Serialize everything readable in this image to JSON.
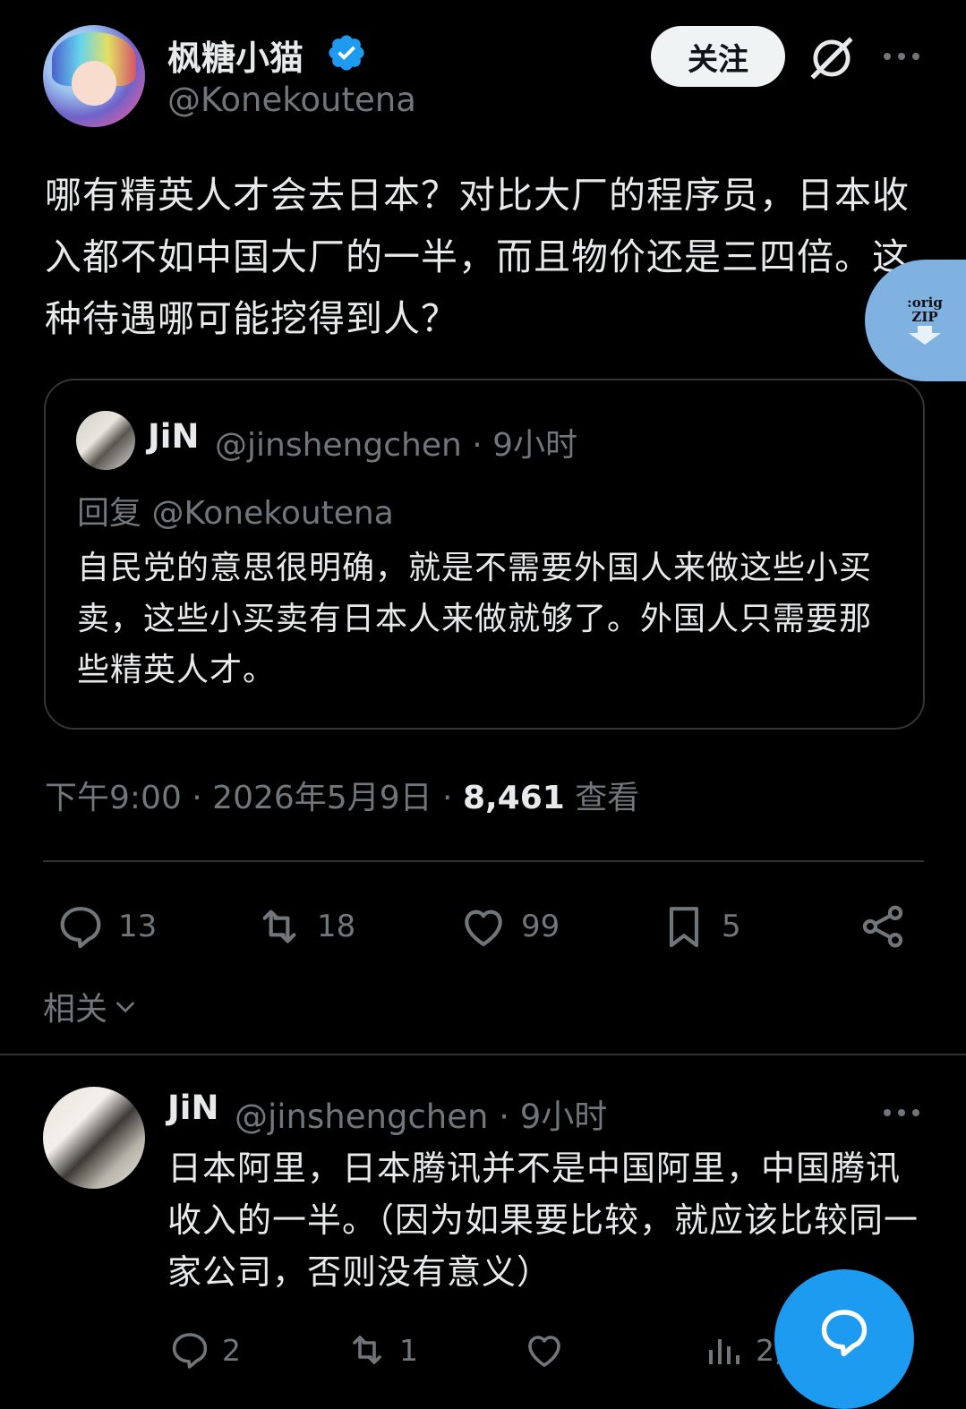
{
  "tweet": {
    "author_name": "枫糖小猫",
    "author_handle": "@Konekoutena",
    "follow_label": "关注",
    "text": "哪有精英人才会去日本？对比大厂的程序员，日本收入都不如中国大厂的一半，而且物价还是三四倍。这种待遇哪可能挖得到人？",
    "time": "下午9:00 · 2026年5月9日 · ",
    "views": "8,461",
    "views_label": " 查看",
    "stats": {
      "replies": "13",
      "retweets": "18",
      "likes": "99",
      "bookmarks": "5"
    }
  },
  "zip_badge": {
    "line1": ":orig",
    "line2": "ZIP"
  },
  "quote": {
    "name": "JiN",
    "meta": "@jinshengchen · 9小时",
    "reply_to": "回复 @Konekoutena",
    "text": "自民党的意思很明确，就是不需要外国人来做这些小买卖，这些小买卖有日本人来做就够了。外国人只需要那些精英人才。"
  },
  "related_label": "相关",
  "reply": {
    "name": "JiN",
    "meta": "@jinshengchen · 9小时",
    "text": "日本阿里，日本腾讯并不是中国阿里，中国腾讯收入的一半。（因为如果要比较，就应该比较同一家公司，否则没有意义）",
    "stats": {
      "replies": "2",
      "retweets": "1",
      "views": "2,272"
    }
  },
  "colors": {
    "background": "#000000",
    "text": "#e7e9ea",
    "muted": "#71767b",
    "accent": "#1d9bf0",
    "divider": "#2f3336"
  }
}
